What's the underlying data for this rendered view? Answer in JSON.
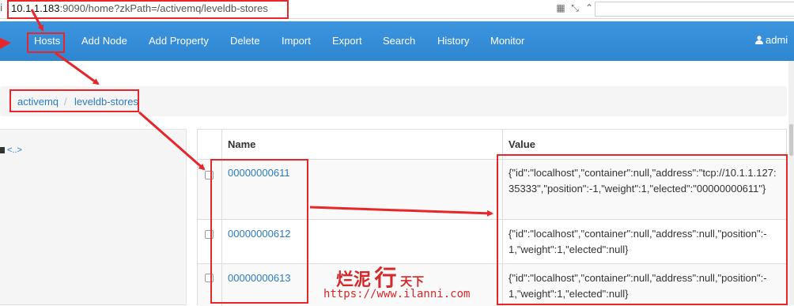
{
  "browser": {
    "url_host": "10.1.1.183",
    "url_rest": ":9090/home?zkPath=/activemq/leveldb-stores",
    "info_icon": "info-icon",
    "tools": [
      "grid-icon",
      "compress-icon",
      "chevron-up-icon"
    ]
  },
  "navbar": {
    "items": [
      "Hosts",
      "Add Node",
      "Add Property",
      "Delete",
      "Import",
      "Export",
      "Search",
      "History",
      "Monitor"
    ],
    "user_label": "admi",
    "user_icon": "user-icon"
  },
  "breadcrumb": {
    "items": [
      "activemq",
      "leveldb-stores"
    ],
    "separator": "/"
  },
  "tree": {
    "parent_label": "<..>"
  },
  "table": {
    "headers": {
      "name": "Name",
      "value": "Value"
    },
    "rows": [
      {
        "name": "00000000611",
        "value": "{\"id\":\"localhost\",\"container\":null,\"address\":\"tcp://10.1.1.127:35333\",\"position\":-1,\"weight\":1,\"elected\":\"00000000611\"}"
      },
      {
        "name": "00000000612",
        "value": "{\"id\":\"localhost\",\"container\":null,\"address\":null,\"position\":-1,\"weight\":1,\"elected\":null}"
      },
      {
        "name": "00000000613",
        "value": "{\"id\":\"localhost\",\"container\":null,\"address\":null,\"position\":-1,\"weight\":1,\"elected\":null}"
      }
    ]
  },
  "watermark": {
    "title_big": "烂泥",
    "title_mid": "行",
    "title_small": "天下",
    "url": "https://www.ilanni.com"
  },
  "colors": {
    "navbar": "#3a8fd8",
    "link": "#2a7bc3",
    "annotation": "#e8262a"
  }
}
